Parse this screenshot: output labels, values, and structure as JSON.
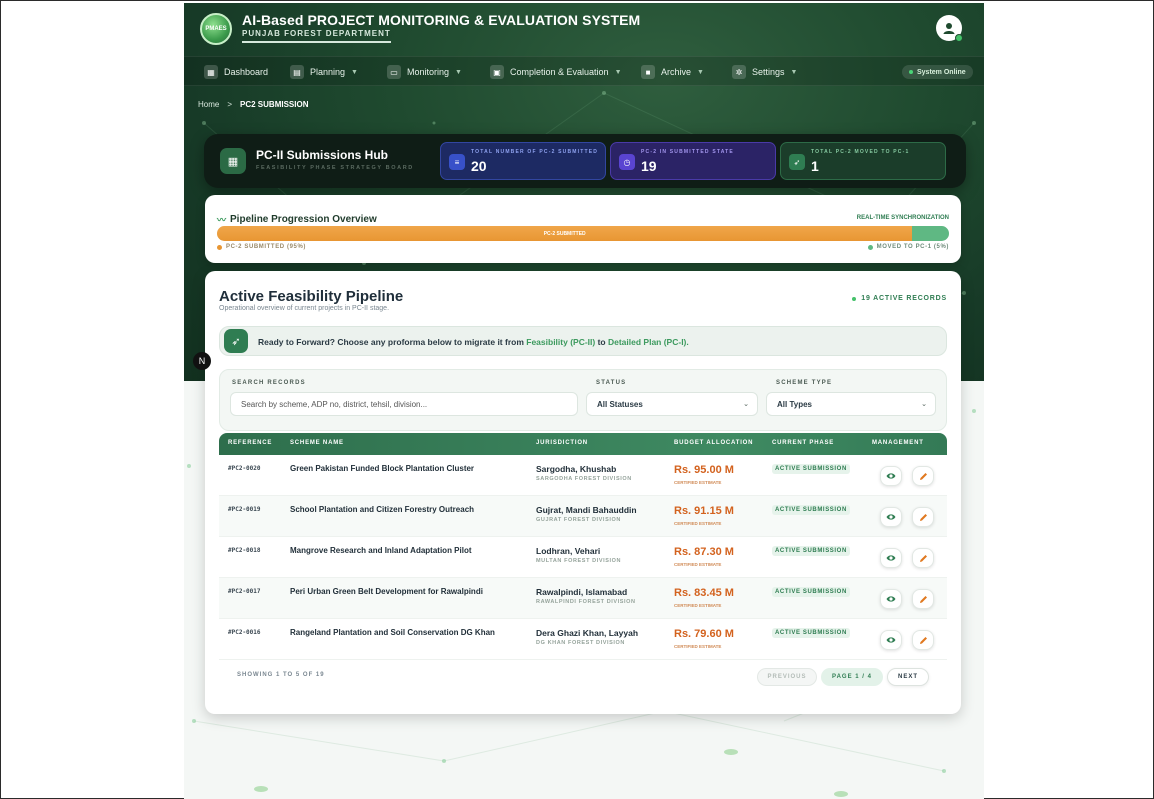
{
  "header": {
    "logo_text": "PMAES",
    "title": "AI-Based PROJECT MONITORING & EVALUATION SYSTEM",
    "subtitle": "PUNJAB FOREST DEPARTMENT"
  },
  "nav": {
    "items": [
      {
        "label": "Dashboard",
        "icon": "dashboard-icon",
        "has_dropdown": false
      },
      {
        "label": "Planning",
        "icon": "planning-icon",
        "has_dropdown": true
      },
      {
        "label": "Monitoring",
        "icon": "monitor-icon",
        "has_dropdown": true
      },
      {
        "label": "Completion & Evaluation",
        "icon": "evaluation-icon",
        "has_dropdown": true
      },
      {
        "label": "Archive",
        "icon": "archive-icon",
        "has_dropdown": true
      },
      {
        "label": "Settings",
        "icon": "gear-icon",
        "has_dropdown": true
      }
    ],
    "status": "System Online"
  },
  "breadcrumb": {
    "home": "Home",
    "separator": ">",
    "current": "PC2 SUBMISSION"
  },
  "hub": {
    "title": "PC-II Submissions Hub",
    "subtitle": "FEASIBILITY PHASE STRATEGY BOARD",
    "stats": [
      {
        "label": "TOTAL NUMBER OF PC-2 SUBMITTED",
        "value": "20"
      },
      {
        "label": "PC-2 IN SUBMITTED STATE",
        "value": "19"
      },
      {
        "label": "TOTAL PC-2 MOVED TO PC-1",
        "value": "1"
      }
    ]
  },
  "progression": {
    "title": "Pipeline Progression Overview",
    "sync_label": "REAL-TIME SYNCHRONIZATION",
    "bar_label": "PC-2 SUBMITTED",
    "submitted_fraction": 0.95,
    "moved_fraction": 0.05,
    "legend_left": "PC-2 SUBMITTED (95%)",
    "legend_right": "MOVED TO PC-1 (5%)",
    "colors": {
      "submitted": "#e89633",
      "moved": "#5fb883"
    }
  },
  "pipeline": {
    "title": "Active Feasibility Pipeline",
    "subtitle": "Operational overview of current projects in PC-II stage.",
    "active_records": "19 ACTIVE RECORDS",
    "forward_prefix": "Ready to Forward? Choose any proforma below to migrate it from ",
    "forward_from": "Feasibility (PC-II)",
    "forward_mid": " to ",
    "forward_to": "Detailed Plan (PC-I).",
    "bubble": "N"
  },
  "filters": {
    "search_label": "SEARCH RECORDS",
    "search_placeholder": "Search by scheme, ADP no, district, tehsil, division...",
    "status_label": "STATUS",
    "status_value": "All Statuses",
    "scheme_label": "SCHEME TYPE",
    "scheme_value": "All Types"
  },
  "table": {
    "headers": [
      "REFERENCE",
      "SCHEME NAME",
      "JURISDICTION",
      "BUDGET ALLOCATION",
      "CURRENT PHASE",
      "MANAGEMENT"
    ],
    "rows": [
      {
        "ref": "#PC2-0020",
        "name": "Green Pakistan Funded Block Plantation Cluster",
        "juris": "Sargodha, Khushab",
        "division": "SARGODHA FOREST DIVISION",
        "budget": "Rs. 95.00 M",
        "budget_note": "CERTIFIED ESTIMATE",
        "phase": "ACTIVE SUBMISSION"
      },
      {
        "ref": "#PC2-0019",
        "name": "School Plantation and Citizen Forestry Outreach",
        "juris": "Gujrat, Mandi Bahauddin",
        "division": "GUJRAT FOREST DIVISION",
        "budget": "Rs. 91.15 M",
        "budget_note": "CERTIFIED ESTIMATE",
        "phase": "ACTIVE SUBMISSION"
      },
      {
        "ref": "#PC2-0018",
        "name": "Mangrove Research and Inland Adaptation Pilot",
        "juris": "Lodhran, Vehari",
        "division": "MULTAN FOREST DIVISION",
        "budget": "Rs. 87.30 M",
        "budget_note": "CERTIFIED ESTIMATE",
        "phase": "ACTIVE SUBMISSION"
      },
      {
        "ref": "#PC2-0017",
        "name": "Peri Urban Green Belt Development for Rawalpindi",
        "juris": "Rawalpindi, Islamabad",
        "division": "RAWALPINDI FOREST DIVISION",
        "budget": "Rs. 83.45 M",
        "budget_note": "CERTIFIED ESTIMATE",
        "phase": "ACTIVE SUBMISSION"
      },
      {
        "ref": "#PC2-0016",
        "name": "Rangeland Plantation and Soil Conservation DG Khan",
        "juris": "Dera Ghazi Khan, Layyah",
        "division": "DG KHAN FOREST DIVISION",
        "budget": "Rs. 79.60 M",
        "budget_note": "CERTIFIED ESTIMATE",
        "phase": "ACTIVE SUBMISSION"
      }
    ],
    "showing": "SHOWING 1 TO 5 OF 19",
    "prev": "PREVIOUS",
    "page": "PAGE 1 / 4",
    "next": "NEXT"
  }
}
